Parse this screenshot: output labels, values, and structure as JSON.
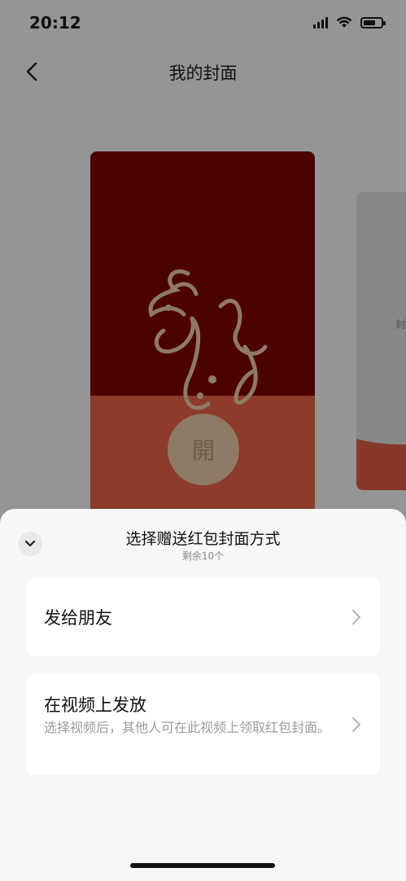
{
  "status_bar": {
    "time": "20:12",
    "icons": [
      "signal-icon",
      "wifi-icon",
      "battery-icon"
    ]
  },
  "nav": {
    "back_icon": "chevron-left-icon",
    "title": "我的封面"
  },
  "cover": {
    "open_label": "開",
    "art": "dragon-calligraphy",
    "next_cover_peek_char": "封"
  },
  "sheet": {
    "collapse_icon": "chevron-down-icon",
    "title": "选择赠送红包封面方式",
    "subtitle": "剩余10个",
    "options": [
      {
        "label": "发给朋友",
        "description": "",
        "icon": "chevron-right-icon"
      },
      {
        "label": "在视频上发放",
        "description": "选择视频后，其他人可在此视频上领取红包封面。",
        "icon": "chevron-right-icon"
      }
    ]
  },
  "colors": {
    "overlay_gray": "#959595",
    "cover_dark_red": "#4d0202",
    "cover_red": "#8d3b2a",
    "gold": "#8f7a66",
    "sheet_bg": "#f7f7f7"
  }
}
